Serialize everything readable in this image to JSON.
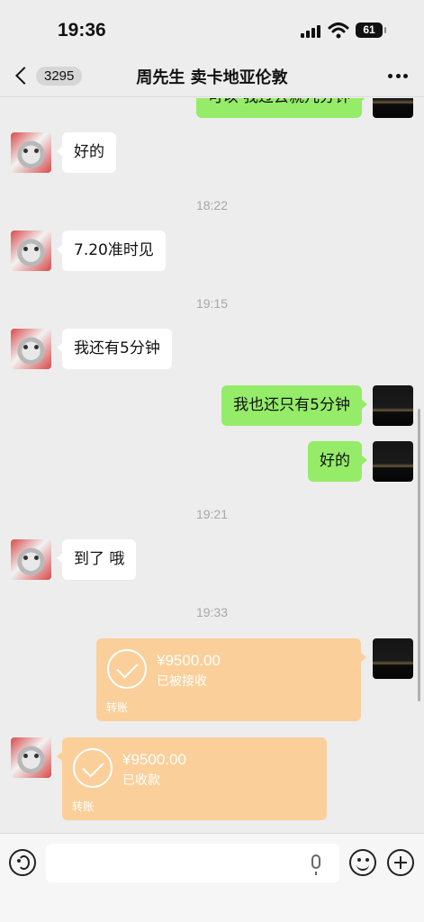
{
  "status_bar": {
    "time": "19:36",
    "battery": "61",
    "icons": [
      "signal-icon",
      "wifi-icon",
      "battery-icon"
    ]
  },
  "nav": {
    "unread_count": "3295",
    "title": "周先生 卖卡地亚伦敦",
    "icons": [
      "back-icon",
      "more-icon"
    ]
  },
  "messages": [
    {
      "kind": "text",
      "from": "me",
      "text": "可以 我过去就几分钟"
    },
    {
      "kind": "text",
      "from": "other",
      "text": "好的"
    },
    {
      "kind": "time",
      "text": "18:22"
    },
    {
      "kind": "text",
      "from": "other",
      "text": "7.20准时见"
    },
    {
      "kind": "time",
      "text": "19:15"
    },
    {
      "kind": "text",
      "from": "other",
      "text": "我还有5分钟"
    },
    {
      "kind": "text",
      "from": "me",
      "text": "我也还只有5分钟"
    },
    {
      "kind": "text",
      "from": "me",
      "text": "好的"
    },
    {
      "kind": "time",
      "text": "19:21"
    },
    {
      "kind": "text",
      "from": "other",
      "text": "到了 哦"
    },
    {
      "kind": "time",
      "text": "19:33"
    },
    {
      "kind": "transfer",
      "from": "me",
      "amount": "¥9500.00",
      "status": "已被接收",
      "footer": "转账"
    },
    {
      "kind": "transfer",
      "from": "other",
      "amount": "¥9500.00",
      "status": "已收款",
      "footer": "转账"
    }
  ],
  "input_bar": {
    "placeholder": "",
    "icons": [
      "voice-icon",
      "microphone-icon",
      "emoji-icon",
      "plus-icon"
    ]
  },
  "colors": {
    "background": "#ededed",
    "outgoing_bubble": "#95ec69",
    "incoming_bubble": "#ffffff",
    "transfer_card": "#fbcf9a"
  }
}
